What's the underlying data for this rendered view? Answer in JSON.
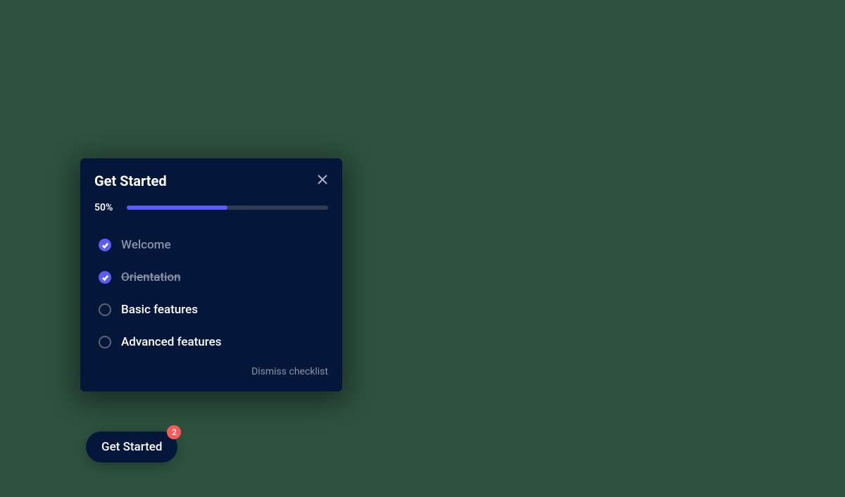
{
  "checklist": {
    "title": "Get Started",
    "progress_label": "50%",
    "progress_percent": 50,
    "items": [
      {
        "label": "Welcome",
        "state": "done-current"
      },
      {
        "label": "Orientation",
        "state": "done-past"
      },
      {
        "label": "Basic features",
        "state": "pending"
      },
      {
        "label": "Advanced features",
        "state": "pending"
      }
    ],
    "dismiss_label": "Dismiss checklist"
  },
  "launcher": {
    "label": "Get Started",
    "badge": "2"
  },
  "colors": {
    "background": "#2e5240",
    "panel": "#05163b",
    "accent": "#5b5bf6",
    "badge": "#fa5a5a"
  }
}
